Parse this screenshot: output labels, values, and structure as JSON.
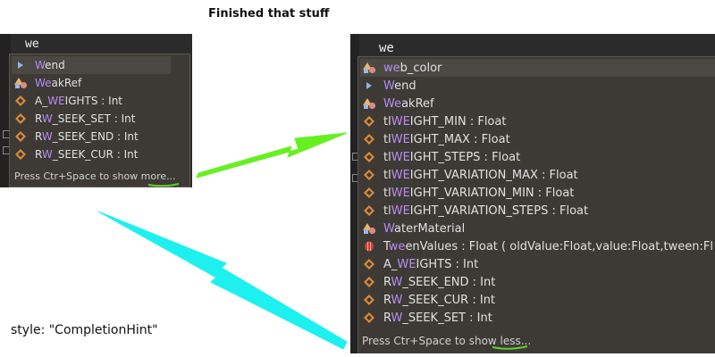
{
  "title": "Finished that stuff",
  "style_label": "style: \"CompletionHint\"",
  "left_panel": {
    "typed_text": "we",
    "items": [
      {
        "icon": "triangle-icon",
        "hl": "W",
        "pre": "",
        "rest": "end",
        "type": ""
      },
      {
        "icon": "shapes-icon",
        "hl": "We",
        "pre": "",
        "rest": "akRef",
        "type": ""
      },
      {
        "icon": "constant-icon",
        "hl": "WE",
        "pre": "A_",
        "rest": "IGHTS",
        "type": " : Int"
      },
      {
        "icon": "constant-icon",
        "hl": "W",
        "pre": "R",
        "rest": "_SEEK_SET",
        "type": " : Int"
      },
      {
        "icon": "constant-icon",
        "hl": "W",
        "pre": "R",
        "rest": "_SEEK_END",
        "type": " : Int"
      },
      {
        "icon": "constant-icon",
        "hl": "W",
        "pre": "R",
        "rest": "_SEEK_CUR",
        "type": " : Int"
      }
    ],
    "footer_prefix": "Press Ctr+Space to show ",
    "footer_link": "more..."
  },
  "right_panel": {
    "typed_text": "we",
    "items": [
      {
        "icon": "shapes-icon",
        "pre": "",
        "hl": "we",
        "rest": "b_color",
        "type": ""
      },
      {
        "icon": "triangle-icon",
        "pre": "",
        "hl": "W",
        "rest": "end",
        "type": ""
      },
      {
        "icon": "shapes-icon",
        "pre": "",
        "hl": "We",
        "rest": "akRef",
        "type": ""
      },
      {
        "icon": "constant-icon",
        "pre": "tl",
        "hl": "WE",
        "rest": "IGHT_MIN",
        "type": " : Float"
      },
      {
        "icon": "constant-icon",
        "pre": "tl",
        "hl": "WE",
        "rest": "IGHT_MAX",
        "type": " : Float"
      },
      {
        "icon": "constant-icon",
        "pre": "tl",
        "hl": "WE",
        "rest": "IGHT_STEPS",
        "type": " : Float"
      },
      {
        "icon": "constant-icon",
        "pre": "tl",
        "hl": "WE",
        "rest": "IGHT_VARIATION_MAX",
        "type": " : Float"
      },
      {
        "icon": "constant-icon",
        "pre": "tl",
        "hl": "WE",
        "rest": "IGHT_VARIATION_MIN",
        "type": " : Float"
      },
      {
        "icon": "constant-icon",
        "pre": "tl",
        "hl": "WE",
        "rest": "IGHT_VARIATION_STEPS",
        "type": " : Float"
      },
      {
        "icon": "shapes-icon",
        "pre": "",
        "hl": "W",
        "rest": "aterMaterial",
        "type": ""
      },
      {
        "icon": "tween-icon",
        "pre": "T",
        "hl": "we",
        "rest": "enValues",
        "type": " : Float ( oldValue:Float,value:Float,tween:Fl"
      },
      {
        "icon": "constant-icon",
        "pre": "A_",
        "hl": "WE",
        "rest": "IGHTS",
        "type": " : Int"
      },
      {
        "icon": "constant-icon",
        "pre": "R",
        "hl": "W",
        "rest": "_SEEK_END",
        "type": " : Int"
      },
      {
        "icon": "constant-icon",
        "pre": "R",
        "hl": "W",
        "rest": "_SEEK_CUR",
        "type": " : Int"
      },
      {
        "icon": "constant-icon",
        "pre": "R",
        "hl": "W",
        "rest": "_SEEK_SET",
        "type": " : Int"
      }
    ],
    "footer_prefix": "Press Ctr+Space to show ",
    "footer_link": "less..."
  },
  "colors": {
    "highlight": "#b78cf4",
    "green_arrow": "#66f020",
    "cyan_arrow": "#1ef0f0",
    "underline": "#5bd12b"
  }
}
